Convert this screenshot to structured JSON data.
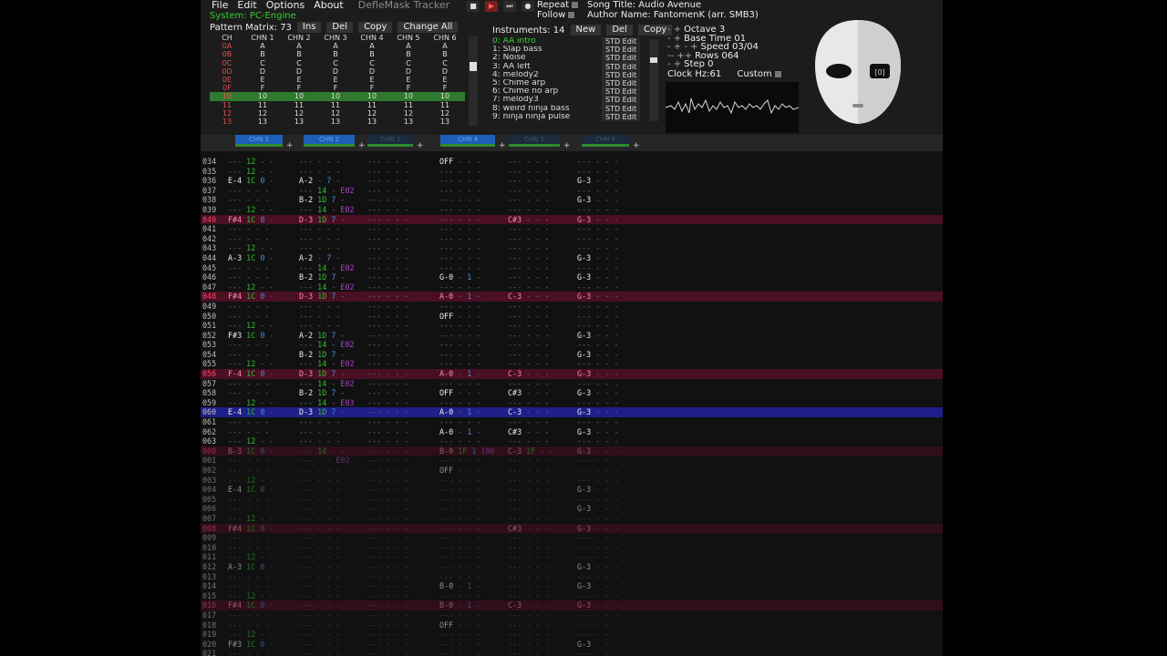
{
  "menu": [
    "File",
    "Edit",
    "Options",
    "About"
  ],
  "app_title": "DefleMask Tracker",
  "transport": {
    "stop": "■",
    "play": "▶",
    "next": "⏭",
    "rec": "●"
  },
  "system": "System: PC-Engine",
  "repeat_label": "Repeat",
  "follow_label": "Follow",
  "song_title": "Song Title: Audio Avenue",
  "author": "Author Name: FantomenK (arr. SMB3)",
  "pattern_matrix": {
    "label": "Pattern Matrix: 73",
    "buttons": [
      "Ins",
      "Del",
      "Copy",
      "Change All"
    ],
    "headers": [
      "CH",
      "CHN 1",
      "CHN 2",
      "CHN 3",
      "CHN 4",
      "CHN 5",
      "CHN 6"
    ],
    "rows": [
      {
        "id": "0A",
        "v": [
          "A",
          "A",
          "A",
          "A",
          "A",
          "A"
        ]
      },
      {
        "id": "0B",
        "v": [
          "B",
          "B",
          "B",
          "B",
          "B",
          "B"
        ]
      },
      {
        "id": "0C",
        "v": [
          "C",
          "C",
          "C",
          "C",
          "C",
          "C"
        ]
      },
      {
        "id": "0D",
        "v": [
          "D",
          "D",
          "D",
          "D",
          "D",
          "D"
        ]
      },
      {
        "id": "0E",
        "v": [
          "E",
          "E",
          "E",
          "E",
          "E",
          "E"
        ]
      },
      {
        "id": "0F",
        "v": [
          "F",
          "F",
          "F",
          "F",
          "F",
          "F"
        ]
      },
      {
        "id": "10",
        "v": [
          "10",
          "10",
          "10",
          "10",
          "10",
          "10"
        ]
      },
      {
        "id": "11",
        "v": [
          "11",
          "11",
          "11",
          "11",
          "11",
          "11"
        ]
      },
      {
        "id": "12",
        "v": [
          "12",
          "12",
          "12",
          "12",
          "12",
          "12"
        ]
      },
      {
        "id": "13",
        "v": [
          "13",
          "13",
          "13",
          "13",
          "13",
          "13"
        ]
      }
    ]
  },
  "instruments": {
    "label": "Instruments: 14",
    "buttons": [
      "New",
      "Del",
      "Copy"
    ],
    "edit_label": "STD Edit",
    "list": [
      "0: AA intro",
      "1: Slap bass",
      "2: Noise",
      "3: AA left",
      "4: melody2",
      "5: Chime arp",
      "6: Chime no arp",
      "7: melody3",
      "8: weird ninja bass",
      "9: ninja ninja pulse"
    ]
  },
  "params": {
    "octave": "Octave 3",
    "base_time": "Base Time 01",
    "speed": "Speed 03/04",
    "rows": "Rows 064",
    "step": "Step 0",
    "clock": "Clock Hz:61",
    "custom": "Custom"
  },
  "channel_tabs": [
    "CHN 1",
    "CHN 2",
    "CHN 3",
    "CHN 4",
    "CHN 5",
    "CHN 6"
  ],
  "pattern_rows": [
    {
      "n": "034",
      "hl": false,
      "c": [
        "--- 12 - -",
        "--- - - -",
        "--- - - -",
        "OFF - - -",
        "--- - - -",
        "--- - - -"
      ]
    },
    {
      "n": "035",
      "hl": false,
      "c": [
        "--- 12 - -",
        "--- - - -",
        "--- - - -",
        "--- - - -",
        "--- - - -",
        "--- - - -"
      ]
    },
    {
      "n": "036",
      "hl": false,
      "c": [
        "E-4 1C 0 -",
        "A-2 - 7 -",
        "--- - - -",
        "--- - - -",
        "--- - - -",
        "G-3 - - -"
      ]
    },
    {
      "n": "037",
      "hl": false,
      "c": [
        "--- - - -",
        "--- 14 - E02",
        "--- - - -",
        "--- - - -",
        "--- - - -",
        "--- - - -"
      ]
    },
    {
      "n": "038",
      "hl": false,
      "c": [
        "--- - - -",
        "B-2 1D 7 -",
        "--- - - -",
        "--- - - -",
        "--- - - -",
        "G-3 - - -"
      ]
    },
    {
      "n": "039",
      "hl": false,
      "c": [
        "--- 12 - -",
        "--- 14 - E02",
        "--- - - -",
        "--- - - -",
        "--- - - -",
        "--- - - -"
      ]
    },
    {
      "n": "040",
      "hl": true,
      "c": [
        "F#4 1C 0 -",
        "D-3 1D 7 -",
        "--- - - -",
        "--- - - -",
        "C#3 - - -",
        "G-3 - - -"
      ]
    },
    {
      "n": "041",
      "hl": false,
      "c": [
        "--- - - -",
        "--- - - -",
        "--- - - -",
        "--- - - -",
        "--- - - -",
        "--- - - -"
      ]
    },
    {
      "n": "042",
      "hl": false,
      "c": [
        "--- - - -",
        "--- - - -",
        "--- - - -",
        "--- - - -",
        "--- - - -",
        "--- - - -"
      ]
    },
    {
      "n": "043",
      "hl": false,
      "c": [
        "--- 12 - -",
        "--- - - -",
        "--- - - -",
        "--- - - -",
        "--- - - -",
        "--- - - -"
      ]
    },
    {
      "n": "044",
      "hl": false,
      "c": [
        "A-3 1C 0 -",
        "A-2 - 7 -",
        "--- - - -",
        "--- - - -",
        "--- - - -",
        "G-3 - - -"
      ]
    },
    {
      "n": "045",
      "hl": false,
      "c": [
        "--- - - -",
        "--- 14 - E02",
        "--- - - -",
        "--- - - -",
        "--- - - -",
        "--- - - -"
      ]
    },
    {
      "n": "046",
      "hl": false,
      "c": [
        "--- - - -",
        "B-2 1D 7 -",
        "--- - - -",
        "G-0 - 1 -",
        "--- - - -",
        "G-3 - - -"
      ]
    },
    {
      "n": "047",
      "hl": false,
      "c": [
        "--- 12 - -",
        "--- 14 - E02",
        "--- - - -",
        "--- - - -",
        "--- - - -",
        "--- - - -"
      ]
    },
    {
      "n": "048",
      "hl": true,
      "c": [
        "F#4 1C 0 -",
        "D-3 1D 7 -",
        "--- - - -",
        "A-0 - 1 -",
        "C-3 - - -",
        "G-3 - - -"
      ]
    },
    {
      "n": "049",
      "hl": false,
      "c": [
        "--- - - -",
        "--- - - -",
        "--- - - -",
        "--- - - -",
        "--- - - -",
        "--- - - -"
      ]
    },
    {
      "n": "050",
      "hl": false,
      "c": [
        "--- - - -",
        "--- - - -",
        "--- - - -",
        "OFF - - -",
        "--- - - -",
        "--- - - -"
      ]
    },
    {
      "n": "051",
      "hl": false,
      "c": [
        "--- 12 - -",
        "--- - - -",
        "--- - - -",
        "--- - - -",
        "--- - - -",
        "--- - - -"
      ]
    },
    {
      "n": "052",
      "hl": false,
      "c": [
        "F#3 1C 0 -",
        "A-2 1D 7 -",
        "--- - - -",
        "--- - - -",
        "--- - - -",
        "G-3 - - -"
      ]
    },
    {
      "n": "053",
      "hl": false,
      "c": [
        "--- - - -",
        "--- 14 - E02",
        "--- - - -",
        "--- - - -",
        "--- - - -",
        "--- - - -"
      ]
    },
    {
      "n": "054",
      "hl": false,
      "c": [
        "--- - - -",
        "B-2 1D 7 -",
        "--- - - -",
        "--- - - -",
        "--- - - -",
        "G-3 - - -"
      ]
    },
    {
      "n": "055",
      "hl": false,
      "c": [
        "--- 12 - -",
        "--- 14 - E02",
        "--- - - -",
        "--- - - -",
        "--- - - -",
        "--- - - -"
      ]
    },
    {
      "n": "056",
      "hl": true,
      "c": [
        "F-4 1C 0 -",
        "D-3 1D 7 -",
        "--- - - -",
        "A-0 - 1 -",
        "C-3 - - -",
        "G-3 - - -"
      ]
    },
    {
      "n": "057",
      "hl": false,
      "c": [
        "--- - - -",
        "--- 14 - E02",
        "--- - - -",
        "--- - - -",
        "--- - - -",
        "--- - - -"
      ]
    },
    {
      "n": "058",
      "hl": false,
      "c": [
        "--- - - -",
        "B-2 1D 7 -",
        "--- - - -",
        "OFF - - -",
        "C#3 - - -",
        "G-3 - - -"
      ]
    },
    {
      "n": "059",
      "hl": false,
      "c": [
        "--- 12 - -",
        "--- 14 - E03",
        "--- - - -",
        "--- - - -",
        "--- - - -",
        "--- - - -"
      ]
    },
    {
      "n": "060",
      "hl": false,
      "cur": true,
      "c": [
        "E-4 1C 0 -",
        "D-3 1D 7 -",
        "--- - - -",
        "A-0 - 1 -",
        "C-3 - - -",
        "G-3 - - -"
      ]
    },
    {
      "n": "061",
      "hl": false,
      "c": [
        "--- - - -",
        "--- - - -",
        "--- - - -",
        "--- - - -",
        "--- - - -",
        "--- - - -"
      ]
    },
    {
      "n": "062",
      "hl": false,
      "c": [
        "--- - - -",
        "--- - - -",
        "--- - - -",
        "A-0 - 1 -",
        "C#3 - - -",
        "G-3 - - -"
      ]
    },
    {
      "n": "063",
      "hl": false,
      "c": [
        "--- 12 - -",
        "--- - - -",
        "--- - - -",
        "--- - - -",
        "--- - - -",
        "--- - - -"
      ]
    },
    {
      "n": "000",
      "hl": true,
      "dim": true,
      "c": [
        "B-3 1C 0 -",
        "--- 14 - -",
        "--- - - -",
        "B-0 1F 1 180",
        "C-3 1F - -",
        "G-3 - - -"
      ]
    },
    {
      "n": "001",
      "hl": false,
      "dim": true,
      "c": [
        "--- - - -",
        "--- - - E02",
        "--- - - -",
        "--- - - -",
        "--- - - -",
        "--- - - -"
      ]
    },
    {
      "n": "002",
      "hl": false,
      "dim": true,
      "c": [
        "--- - - -",
        "--- - - -",
        "--- - - -",
        "OFF - - -",
        "--- - - -",
        "--- - - -"
      ]
    },
    {
      "n": "003",
      "hl": false,
      "dim": true,
      "c": [
        "--- 12 - -",
        "--- - - -",
        "--- - - -",
        "--- - - -",
        "--- - - -",
        "--- - - -"
      ]
    },
    {
      "n": "004",
      "hl": false,
      "dim": true,
      "c": [
        "E-4 1C 0 -",
        "--- - - -",
        "--- - - -",
        "--- - - -",
        "--- - - -",
        "G-3 - - -"
      ]
    },
    {
      "n": "005",
      "hl": false,
      "dim": true,
      "c": [
        "--- - - -",
        "--- - - -",
        "--- - - -",
        "--- - - -",
        "--- - - -",
        "--- - - -"
      ]
    },
    {
      "n": "006",
      "hl": false,
      "dim": true,
      "c": [
        "--- - - -",
        "--- - - -",
        "--- - - -",
        "--- - - -",
        "--- - - -",
        "G-3 - - -"
      ]
    },
    {
      "n": "007",
      "hl": false,
      "dim": true,
      "c": [
        "--- 12 - -",
        "--- - - -",
        "--- - - -",
        "--- - - -",
        "--- - - -",
        "--- - - -"
      ]
    },
    {
      "n": "008",
      "hl": true,
      "dim": true,
      "c": [
        "F#4 1C 0 -",
        "--- - - -",
        "--- - - -",
        "--- - - -",
        "C#3 - - -",
        "G-3 - - -"
      ]
    },
    {
      "n": "009",
      "hl": false,
      "dim": true,
      "c": [
        "--- - - -",
        "--- - - -",
        "--- - - -",
        "--- - - -",
        "--- - - -",
        "--- - - -"
      ]
    },
    {
      "n": "010",
      "hl": false,
      "dim": true,
      "c": [
        "--- - - -",
        "--- - - -",
        "--- - - -",
        "--- - - -",
        "--- - - -",
        "--- - - -"
      ]
    },
    {
      "n": "011",
      "hl": false,
      "dim": true,
      "c": [
        "--- 12 - -",
        "--- - - -",
        "--- - - -",
        "--- - - -",
        "--- - - -",
        "--- - - -"
      ]
    },
    {
      "n": "012",
      "hl": false,
      "dim": true,
      "c": [
        "A-3 1C 0 -",
        "--- - - -",
        "--- - - -",
        "--- - - -",
        "--- - - -",
        "G-3 - - -"
      ]
    },
    {
      "n": "013",
      "hl": false,
      "dim": true,
      "c": [
        "--- - - -",
        "--- - - -",
        "--- - - -",
        "--- - - -",
        "--- - - -",
        "--- - - -"
      ]
    },
    {
      "n": "014",
      "hl": false,
      "dim": true,
      "c": [
        "--- - - -",
        "--- - - -",
        "--- - - -",
        "B-0 - 1 -",
        "--- - - -",
        "G-3 - - -"
      ]
    },
    {
      "n": "015",
      "hl": false,
      "dim": true,
      "c": [
        "--- 12 - -",
        "--- - - -",
        "--- - - -",
        "--- - - -",
        "--- - - -",
        "--- - - -"
      ]
    },
    {
      "n": "016",
      "hl": true,
      "dim": true,
      "c": [
        "F#4 1C 0 -",
        "--- - - -",
        "--- - - -",
        "B-0 - 1 -",
        "C-3 - - -",
        "G-3 - - -"
      ]
    },
    {
      "n": "017",
      "hl": false,
      "dim": true,
      "c": [
        "--- - - -",
        "--- - - -",
        "--- - - -",
        "--- - - -",
        "--- - - -",
        "--- - - -"
      ]
    },
    {
      "n": "018",
      "hl": false,
      "dim": true,
      "c": [
        "--- - - -",
        "--- - - -",
        "--- - - -",
        "OFF - - -",
        "--- - - -",
        "--- - - -"
      ]
    },
    {
      "n": "019",
      "hl": false,
      "dim": true,
      "c": [
        "--- 12 - -",
        "--- - - -",
        "--- - - -",
        "--- - - -",
        "--- - - -",
        "--- - - -"
      ]
    },
    {
      "n": "020",
      "hl": false,
      "dim": true,
      "c": [
        "F#3 1C 0 -",
        "--- - - -",
        "--- - - -",
        "--- - - -",
        "--- - - -",
        "G-3 - - -"
      ]
    },
    {
      "n": "021",
      "hl": false,
      "dim": true,
      "c": [
        "--- - - -",
        "--- - - -",
        "--- - - -",
        "--- - - -",
        "--- - - -",
        "--- - - -"
      ]
    }
  ]
}
